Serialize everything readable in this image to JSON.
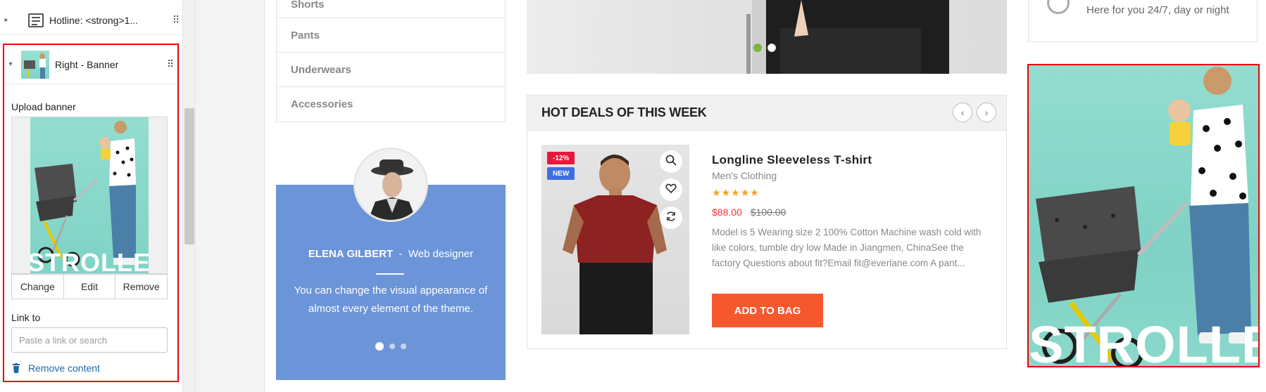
{
  "editor": {
    "hotline_title": "Hotline: <strong>1...",
    "banner_title": "Right - Banner",
    "upload_label": "Upload banner",
    "banner_text": "STROLLER",
    "buttons": {
      "change": "Change",
      "edit": "Edit",
      "remove": "Remove"
    },
    "link_label": "Link to",
    "link_placeholder": "Paste a link or search",
    "remove_content": "Remove content"
  },
  "store": {
    "categories": [
      "Shorts",
      "Pants",
      "Underwears",
      "Accessories"
    ],
    "testimonial": {
      "name": "ELENA GILBERT",
      "separator": "-",
      "role": "Web designer",
      "text": "You can change the visual appearance of almost every element of the theme.",
      "dots": 3,
      "active_dot": 0
    },
    "hero": {
      "dots": 2,
      "active_dot": 0
    },
    "deals": {
      "title": "HOT DEALS OF THIS WEEK",
      "prev_icon": "chevron-left-icon",
      "next_icon": "chevron-right-icon",
      "product": {
        "badge_sale": "-12%",
        "badge_new": "NEW",
        "name": "Longline Sleeveless T-shirt",
        "category": "Men's Clothing",
        "rating": 5,
        "price": "$88.00",
        "old_price": "$100.00",
        "description": "Model is 5 Wearing size 2 100% Cotton Machine wash cold with like colors, tumble dry low Made in Jiangmen, ChinaSee the factory Questions about fit?Email fit@everlane.com A pant...",
        "add_to_bag": "ADD TO BAG"
      }
    },
    "support": {
      "text": "Here for you 24/7, day or night"
    },
    "right_banner": {
      "text": "STROLLER"
    }
  },
  "colors": {
    "highlight": "#ee0000",
    "testimonial_bg": "#6c94d8",
    "add_to_bag": "#f6582d",
    "sale_badge": "#e8173b",
    "new_badge": "#3d6fe0",
    "banner_bg": "#8ad8cb",
    "link": "#1d68a8"
  }
}
